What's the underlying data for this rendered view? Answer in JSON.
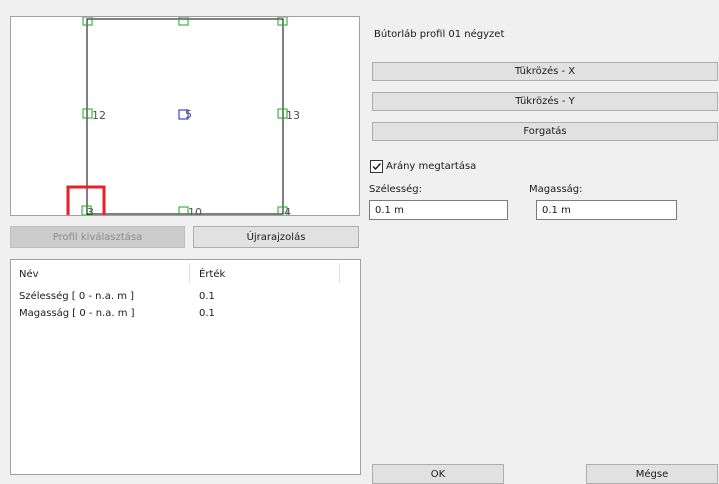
{
  "preview": {
    "nodes": [
      {
        "id": "3",
        "label": "3"
      },
      {
        "id": "5",
        "label": "5"
      },
      {
        "id": "10",
        "label": "10"
      },
      {
        "id": "12",
        "label": "12"
      },
      {
        "id": "13",
        "label": "13"
      },
      {
        "id": "4",
        "label": "4"
      }
    ]
  },
  "buttons": {
    "select_profile": "Profil kiválasztása",
    "redraw": "Újrarajzolás",
    "mirror_x": "Tükrözés - X",
    "mirror_y": "Tükrözés - Y",
    "rotate": "Forgatás",
    "ok": "OK",
    "cancel": "Mégse"
  },
  "properties": {
    "header_name": "Név",
    "header_value": "Érték",
    "rows": [
      {
        "name": "Szélesség [ 0 - n.a. m ]",
        "value": "0.1"
      },
      {
        "name": "Magasság [ 0 - n.a. m ]",
        "value": "0.1"
      }
    ]
  },
  "panel": {
    "profile_title": "Bútorláb profil 01 négyzet",
    "keep_ratio_label": "Arány megtartása",
    "keep_ratio_checked": true,
    "width_label": "Szélesség:",
    "width_value": "0.1 m",
    "height_label": "Magasság:",
    "height_value": "0.1 m"
  },
  "colors": {
    "node_green": "#1aa81a",
    "node_blue": "#1a1ad6",
    "highlight_red": "#e8202a",
    "outline": "#000000"
  }
}
